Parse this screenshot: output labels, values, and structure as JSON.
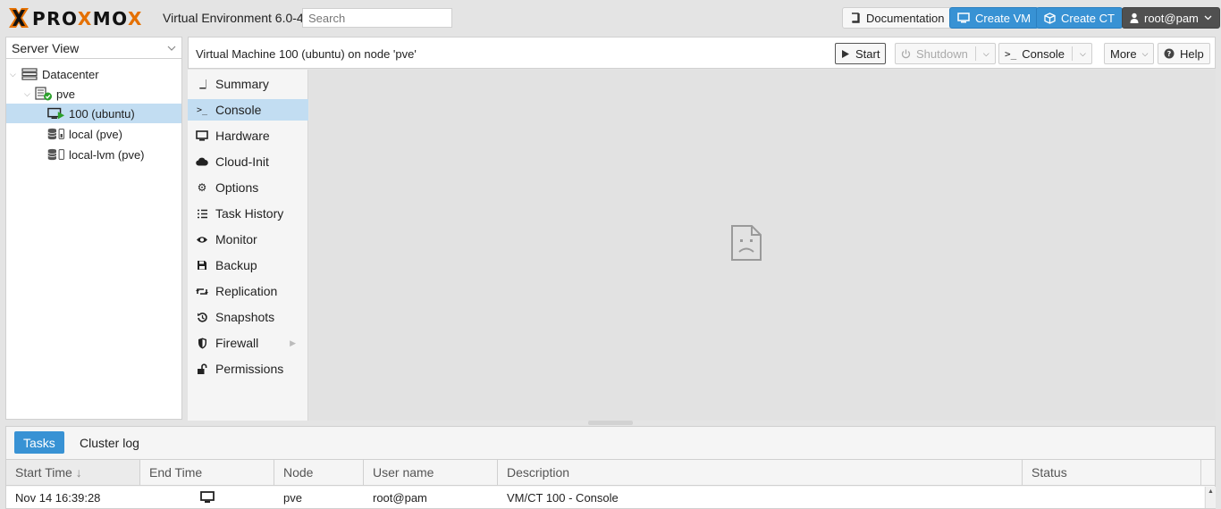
{
  "header": {
    "brand_colors": {
      "accent": "#e57000",
      "blue": "#3892d4"
    },
    "product": "Virtual Environment 6.0-4",
    "search_placeholder": "Search",
    "documentation_label": "Documentation",
    "create_vm_label": "Create VM",
    "create_ct_label": "Create CT",
    "user_label": "root@pam"
  },
  "tree": {
    "view_select": "Server View",
    "items": [
      {
        "label": "Datacenter",
        "icon": "datacenter-icon"
      },
      {
        "label": "pve",
        "icon": "node-online-icon"
      },
      {
        "label": "100 (ubuntu)",
        "icon": "vm-running-icon"
      },
      {
        "label": "local (pve)",
        "icon": "storage-icon"
      },
      {
        "label": "local-lvm (pve)",
        "icon": "storage-icon"
      }
    ]
  },
  "content": {
    "title": "Virtual Machine 100 (ubuntu) on node 'pve'",
    "toolbar": {
      "start": "Start",
      "shutdown": "Shutdown",
      "console": "Console",
      "more": "More",
      "help": "Help"
    }
  },
  "side_menu": {
    "items": [
      {
        "label": "Summary",
        "icon": "book-icon"
      },
      {
        "label": "Console",
        "icon": "terminal-icon"
      },
      {
        "label": "Hardware",
        "icon": "monitor-icon"
      },
      {
        "label": "Cloud-Init",
        "icon": "cloud-icon"
      },
      {
        "label": "Options",
        "icon": "gear-icon"
      },
      {
        "label": "Task History",
        "icon": "list-icon"
      },
      {
        "label": "Monitor",
        "icon": "eye-icon"
      },
      {
        "label": "Backup",
        "icon": "floppy-icon"
      },
      {
        "label": "Replication",
        "icon": "retweet-icon"
      },
      {
        "label": "Snapshots",
        "icon": "history-icon"
      },
      {
        "label": "Firewall",
        "icon": "shield-icon"
      },
      {
        "label": "Permissions",
        "icon": "unlock-icon"
      }
    ],
    "active": "Console"
  },
  "bottom": {
    "tabs": [
      "Tasks",
      "Cluster log"
    ],
    "columns": [
      "Start Time",
      "End Time",
      "Node",
      "User name",
      "Description",
      "Status"
    ],
    "sort_indicator": "↓",
    "rows": [
      {
        "start_time": "Nov 14 16:39:28",
        "end_time_icon": "monitor-icon",
        "node": "pve",
        "user": "root@pam",
        "description": "VM/CT 100 - Console",
        "status": ""
      }
    ]
  }
}
